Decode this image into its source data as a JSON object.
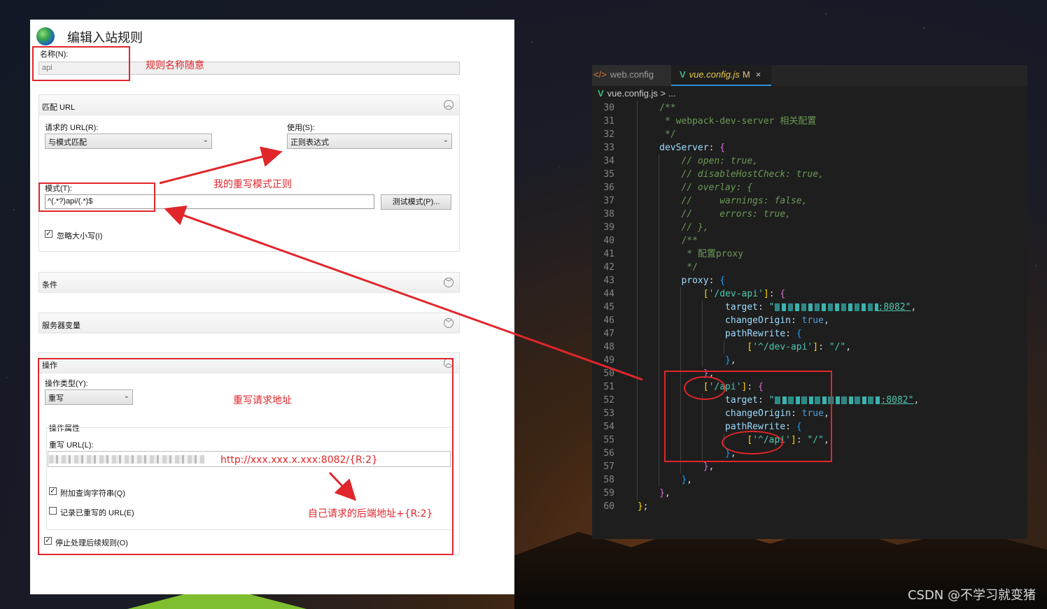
{
  "iis": {
    "title": "编辑入站规则",
    "name_label": "名称(N):",
    "name_value": "api",
    "match_section": "匹配 URL",
    "requested_url_label": "请求的 URL(R):",
    "requested_url_value": "与模式匹配",
    "using_label": "使用(S):",
    "using_value": "正则表达式",
    "pattern_label": "模式(T):",
    "pattern_value": "^(.*?)api/(.*)$",
    "test_button": "测试模式(P)...",
    "ignore_case_label": "忽略大小写(I)",
    "conditions_section": "条件",
    "server_vars_section": "服务器变量",
    "action_section": "操作",
    "action_type_label": "操作类型(Y):",
    "action_type_value": "重写",
    "action_props_label": "操作属性",
    "rewrite_url_label": "重写 URL(L):",
    "append_query_label": "附加查询字符串(Q)",
    "log_rewritten_label": "记录已重写的 URL(E)",
    "stop_processing_label": "停止处理后续规则(O)"
  },
  "annotations": {
    "rule_name_note": "规则名称随意",
    "pattern_note": "我的重写模式正则",
    "rewrite_note": "重写请求地址",
    "rewrite_url_example": "http://xxx.xxx.x.xxx:8082/{R:2}",
    "backend_note": "自己请求的后端地址+{R:2}"
  },
  "editor": {
    "tabs": [
      {
        "label": "web.config",
        "icon": "html-file-icon"
      },
      {
        "label": "vue.config.js",
        "icon": "vue-icon",
        "modified": "M",
        "close": "×"
      }
    ],
    "breadcrumb_file": "vue.config.js",
    "breadcrumb_rest": "> ...",
    "line_numbers": [
      "30",
      "31",
      "32",
      "33",
      "34",
      "35",
      "36",
      "37",
      "38",
      "39",
      "40",
      "41",
      "42",
      "43",
      "44",
      "45",
      "46",
      "47",
      "48",
      "49",
      "50",
      "51",
      "52",
      "53",
      "54",
      "55",
      "56",
      "57",
      "58",
      "59",
      "60"
    ]
  },
  "watermark": "CSDN @不学习就变猪",
  "colors": {
    "annotation_red": "#e0262b",
    "editor_bg": "#1e1e1e"
  }
}
